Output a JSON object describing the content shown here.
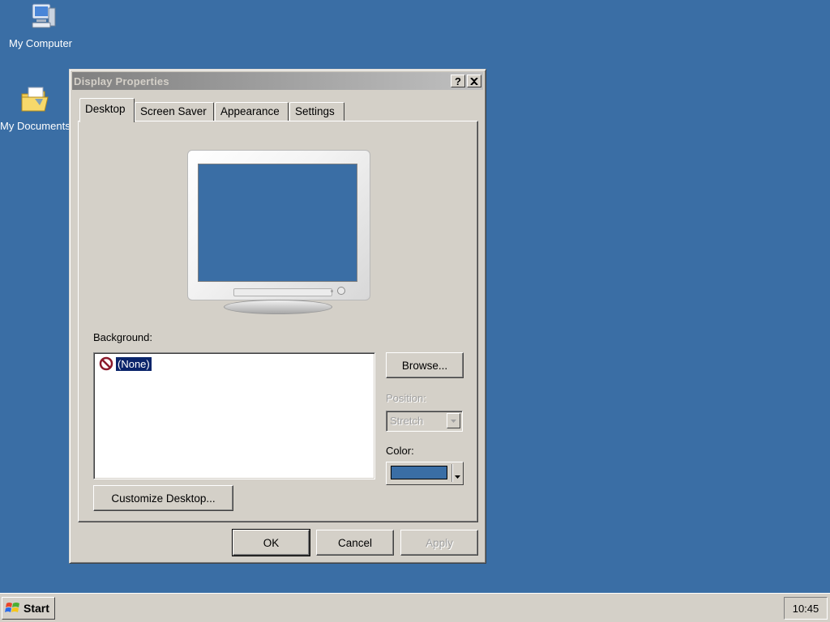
{
  "desktop": {
    "background_color": "#3a6ea5",
    "icons": [
      {
        "label": "My Computer",
        "icon": "computer-icon"
      },
      {
        "label": "My Documents",
        "icon": "documents-folder-icon"
      }
    ]
  },
  "window": {
    "title": "Display Properties",
    "help_button": "?",
    "close_button": "✕",
    "tabs": [
      {
        "label": "Desktop",
        "active": true
      },
      {
        "label": "Screen Saver",
        "active": false
      },
      {
        "label": "Appearance",
        "active": false
      },
      {
        "label": "Settings",
        "active": false
      }
    ],
    "desktop_tab": {
      "preview_color": "#3a6ea5",
      "background_label": "Background:",
      "background_items": [
        {
          "label": "(None)",
          "icon": "none-icon",
          "selected": true
        }
      ],
      "browse_button": "Browse...",
      "position_label": "Position:",
      "position_value": "Stretch",
      "color_label": "Color:",
      "color_value": "#3a6ea5",
      "customize_button": "Customize Desktop..."
    },
    "footer": {
      "ok": "OK",
      "cancel": "Cancel",
      "apply": "Apply"
    }
  },
  "taskbar": {
    "start_label": "Start",
    "clock": "10:45"
  }
}
